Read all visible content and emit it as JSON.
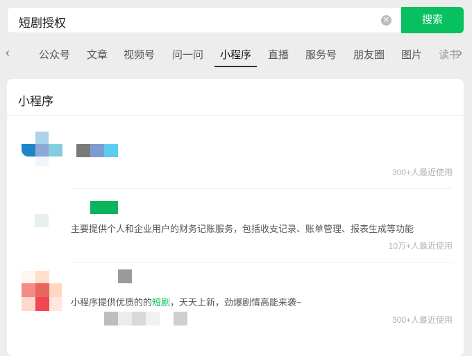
{
  "search": {
    "query": "短剧授权",
    "button_label": "搜索",
    "clear_icon": "clear-circle-icon"
  },
  "tabs": {
    "items": [
      {
        "label": "公众号"
      },
      {
        "label": "文章"
      },
      {
        "label": "视频号"
      },
      {
        "label": "问一问"
      },
      {
        "label": "小程序",
        "active": true
      },
      {
        "label": "直播"
      },
      {
        "label": "服务号"
      },
      {
        "label": "朋友圈"
      },
      {
        "label": "图片"
      },
      {
        "label": "读书"
      }
    ],
    "left_arrow": "‹",
    "right_arrow": "›"
  },
  "section": {
    "title": "小程序"
  },
  "results": [
    {
      "description": "",
      "usage": "300+人最近使用"
    },
    {
      "description": "主要提供个人和企业用户的财务记账服务，包括收支记录、账单管理、报表生成等功能",
      "usage": "10万+人最近使用"
    },
    {
      "description_before": "小程序提供优质的的",
      "description_highlight": "短剧",
      "description_after": "，天天上新，劲爆剧情高能来袭~",
      "usage": "300+人最近使用"
    }
  ],
  "colors": {
    "accent": "#07c160",
    "background": "#ededed"
  }
}
